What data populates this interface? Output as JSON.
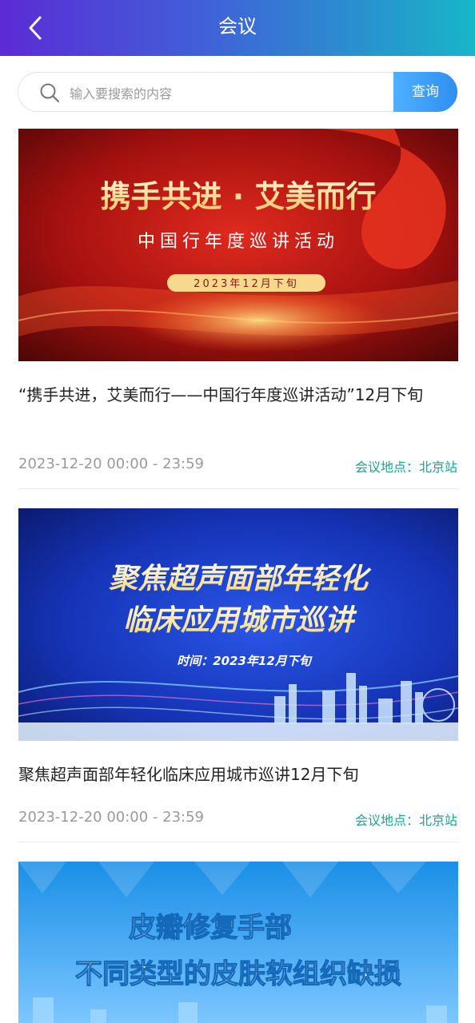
{
  "header": {
    "title": "会议"
  },
  "search": {
    "placeholder": "输入要搜索的内容",
    "button_label": "查询"
  },
  "meetings": [
    {
      "title": "“携手共进，艾美而行——中国行年度巡讲活动”12月下旬",
      "date": "2023-12-20 00:00 - 23:59",
      "location": "会议地点：北京站",
      "banner": {
        "headline": "携手共进 · 艾美而行",
        "subline": "中国行年度巡讲活动",
        "badge": "2023年12月下旬"
      }
    },
    {
      "title": "聚焦超声面部年轻化临床应用城市巡讲12月下旬",
      "date": "2023-12-20 00:00 - 23:59",
      "location": "会议地点：北京站",
      "banner": {
        "line1": "聚焦超声面部年轻化",
        "line2": "临床应用城市巡讲",
        "time": "时间：2023年12月下旬"
      }
    },
    {
      "banner": {
        "line1": "皮瓣修复手部",
        "line2": "不同类型的皮肤软组织缺损"
      }
    }
  ],
  "colors": {
    "header_start": "#5b2bd6",
    "header_end": "#17b6c7",
    "location": "#1aa394",
    "search_button": "#2e8ff0"
  }
}
